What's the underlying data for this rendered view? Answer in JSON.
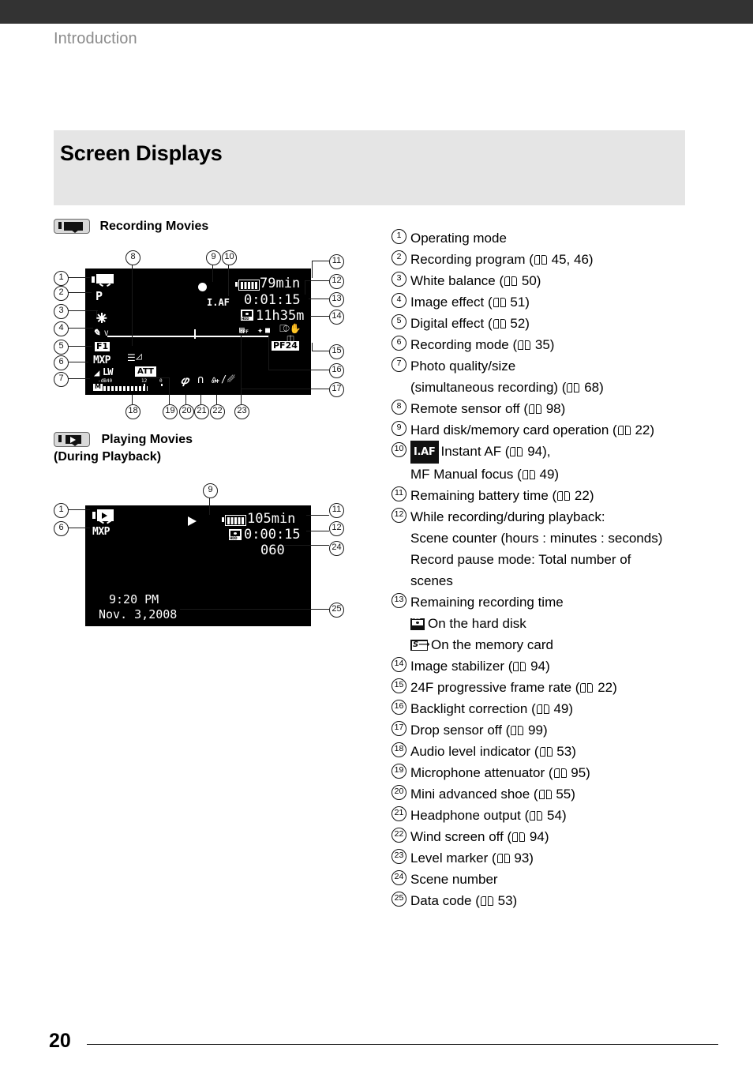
{
  "page": {
    "running_head": "Introduction",
    "title": "Screen Displays",
    "page_number": "20"
  },
  "sections": [
    {
      "id": "recording",
      "label": "Recording Movies",
      "icon": "camcorder-record-icon"
    },
    {
      "id": "playing",
      "label": "Playing Movies",
      "sublabel": "(During Playback)",
      "icon": "camcorder-play-icon"
    }
  ],
  "recording_screen": {
    "operating_mode_icon": "camcorder-icon",
    "recording_program": "P",
    "white_balance_icon": "daylight-sun-icon",
    "image_effect": "V",
    "digital_effect": "F1",
    "recording_mode": "MXP",
    "photo_quality_size": "LW",
    "remote_sensor_off_icon": "remote-sensor-off-icon",
    "record_indicator_icon": "record-dot-icon",
    "instant_af": "I.AF",
    "battery_time": "79min",
    "scene_counter": "0:01:15",
    "remaining_time": "11h35m",
    "remaining_media_icon": "hdd-icon",
    "drop_sensor_off": "OFF",
    "backlight_icon": "backlight-correction-icon",
    "image_stabilizer_icon": "image-stabilizer-icon",
    "frame_rate": "PF24",
    "mic_attenuator": "ATT",
    "audio_level_min": "-dB40",
    "audio_level_mid": "12",
    "audio_level_max": "0",
    "audio_mode": "M",
    "mini_shoe_icon": "mini-advanced-shoe-icon",
    "headphone_icon": "headphone-icon",
    "wind_screen_off": "OFF",
    "mic_icon": "microphone-icon",
    "level_marker_icon": "level-marker-icon"
  },
  "playback_screen": {
    "operating_mode_icon": "camcorder-play-icon",
    "recording_mode": "MXP",
    "playback_icon": "play-triangle-icon",
    "battery_time": "105min",
    "media_icon": "hdd-icon",
    "scene_counter": "0:00:15",
    "scene_number": "060",
    "data_code_time": "9:20 PM",
    "data_code_date": "Nov.  3,2008"
  },
  "callouts": {
    "recording": [
      "1",
      "2",
      "3",
      "4",
      "5",
      "6",
      "7",
      "8",
      "9",
      "10",
      "11",
      "12",
      "13",
      "14",
      "15",
      "16",
      "17",
      "18",
      "19",
      "20",
      "21",
      "22",
      "23"
    ],
    "playback": [
      "1",
      "6",
      "9",
      "11",
      "12",
      "24",
      "25"
    ]
  },
  "legend": [
    {
      "n": "1",
      "text": "Operating mode"
    },
    {
      "n": "2",
      "text": "Recording program (",
      "ref": "45, 46",
      "tail": ")"
    },
    {
      "n": "3",
      "text": "White balance (",
      "ref": "50",
      "tail": ")"
    },
    {
      "n": "4",
      "text": "Image effect (",
      "ref": "51",
      "tail": ")"
    },
    {
      "n": "5",
      "text": "Digital effect (",
      "ref": "52",
      "tail": ")"
    },
    {
      "n": "6",
      "text": "Recording mode (",
      "ref": "35",
      "tail": ")"
    },
    {
      "n": "7",
      "text": "Photo quality/size",
      "line2_pre": "(simultaneous recording) (",
      "ref": "68",
      "tail": ")"
    },
    {
      "n": "8",
      "text": "Remote sensor off (",
      "ref": "98",
      "tail": ")"
    },
    {
      "n": "9",
      "text": "Hard disk/memory card operation (",
      "ref": "22",
      "tail": ")"
    },
    {
      "n": "10",
      "chip": "I.AF",
      "text": "Instant AF (",
      "ref": "94",
      "tail": "),",
      "line2_pre": "MF Manual focus (",
      "ref2": "49",
      "tail2": ")"
    },
    {
      "n": "11",
      "text": "Remaining battery time (",
      "ref": "22",
      "tail": ")"
    },
    {
      "n": "12",
      "text": "While recording/during playback:",
      "lines": [
        "Scene counter (hours : minutes : seconds)",
        "Record pause mode: Total number of",
        "scenes"
      ]
    },
    {
      "n": "13",
      "text": "Remaining recording time",
      "media_lines": [
        {
          "icon": "hdd-chip",
          "label": "On the hard disk"
        },
        {
          "icon": "sd-chip",
          "label": "On the memory card"
        }
      ]
    },
    {
      "n": "14",
      "text": "Image stabilizer (",
      "ref": "94",
      "tail": ")"
    },
    {
      "n": "15",
      "text": "24F progressive frame rate (",
      "ref": "22",
      "tail": ")"
    },
    {
      "n": "16",
      "text": "Backlight correction (",
      "ref": "49",
      "tail": ")"
    },
    {
      "n": "17",
      "text": "Drop sensor off (",
      "ref": "99",
      "tail": ")"
    },
    {
      "n": "18",
      "text": "Audio level indicator (",
      "ref": "53",
      "tail": ")"
    },
    {
      "n": "19",
      "text": "Microphone attenuator (",
      "ref": "95",
      "tail": ")"
    },
    {
      "n": "20",
      "text": "Mini advanced shoe (",
      "ref": "55",
      "tail": ")"
    },
    {
      "n": "21",
      "text": "Headphone output (",
      "ref": "54",
      "tail": ")"
    },
    {
      "n": "22",
      "text": "Wind screen off (",
      "ref": "94",
      "tail": ")"
    },
    {
      "n": "23",
      "text": "Level marker (",
      "ref": "93",
      "tail": ")"
    },
    {
      "n": "24",
      "text": "Scene number"
    },
    {
      "n": "25",
      "text": "Data code (",
      "ref": "53",
      "tail": ")"
    }
  ],
  "colors": {
    "topbar": "#333333",
    "title_band": "#e5e5e5",
    "running_head": "#8b8b8b",
    "screen_bg": "#000000"
  }
}
